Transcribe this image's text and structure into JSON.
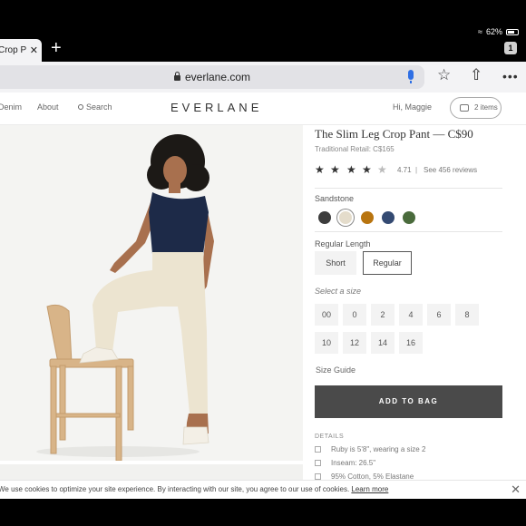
{
  "status": {
    "battery": "62%"
  },
  "tabs": {
    "active_title": "Crop P",
    "count": "1"
  },
  "address_bar": {
    "url": "everlane.com"
  },
  "site_nav": {
    "links": [
      "Denim",
      "About",
      "Search"
    ],
    "brand": "EVERLANE",
    "greeting": "Hi, Maggie",
    "cart": "2 items"
  },
  "product": {
    "title": "The Slim Leg Crop Pant — C$90",
    "retail": "Traditional Retail: C$165",
    "rating": {
      "value": "4.71",
      "stars": 4.71,
      "reviews_link": "See 456 reviews"
    },
    "color": {
      "label": "Sandstone",
      "swatches": [
        "#3d3d3d",
        "#e4dccb",
        "#b8740f",
        "#344a72",
        "#4a6b3c"
      ],
      "selected_index": 1
    },
    "length": {
      "label": "Regular Length",
      "options": [
        "Short",
        "Regular"
      ],
      "selected": "Regular"
    },
    "size": {
      "label": "Select a size",
      "options": [
        "00",
        "0",
        "2",
        "4",
        "6",
        "8",
        "10",
        "12",
        "14",
        "16"
      ]
    },
    "size_guide": "Size Guide",
    "add_to_bag": "ADD TO BAG",
    "details": {
      "label": "DETAILS",
      "items": [
        "Ruby is 5'8\", wearing a size 2",
        "Inseam: 26.5\"",
        "95% Cotton, 5% Elastane"
      ]
    }
  },
  "cookie_bar": {
    "text": "We use cookies to optimize your site experience. By interacting with our site, you agree to our use of cookies.",
    "link": "Learn more"
  }
}
